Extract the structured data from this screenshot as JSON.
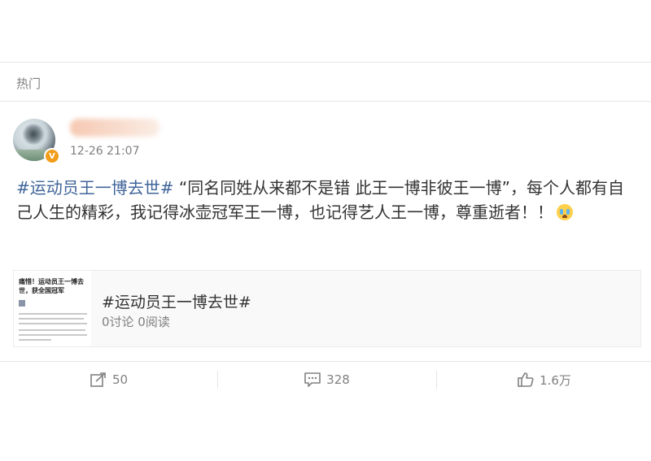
{
  "feed": {
    "section_label": "热门"
  },
  "post": {
    "timestamp": "12-26 21:07",
    "verified_badge": "V",
    "text_hashtag": "#运动员王一博去世#",
    "text_body": " “同名同姓从来都不是错 此王一博非彼王一博”，每个人都有自己人生的精彩，我记得冰壶冠军王一博，也记得艺人王一博，尊重逝者！！",
    "emoji": "crying-face"
  },
  "topic_card": {
    "thumbnail_headline": "痛惜！运动员王一博去世，获全国冠军",
    "title": "#运动员王一博去世#",
    "meta": "0讨论 0阅读"
  },
  "actions": {
    "repost_count": "50",
    "comment_count": "328",
    "like_count": "1.6万"
  },
  "colors": {
    "link": "#406599",
    "muted": "#808080",
    "divider": "#e6e6e6"
  }
}
